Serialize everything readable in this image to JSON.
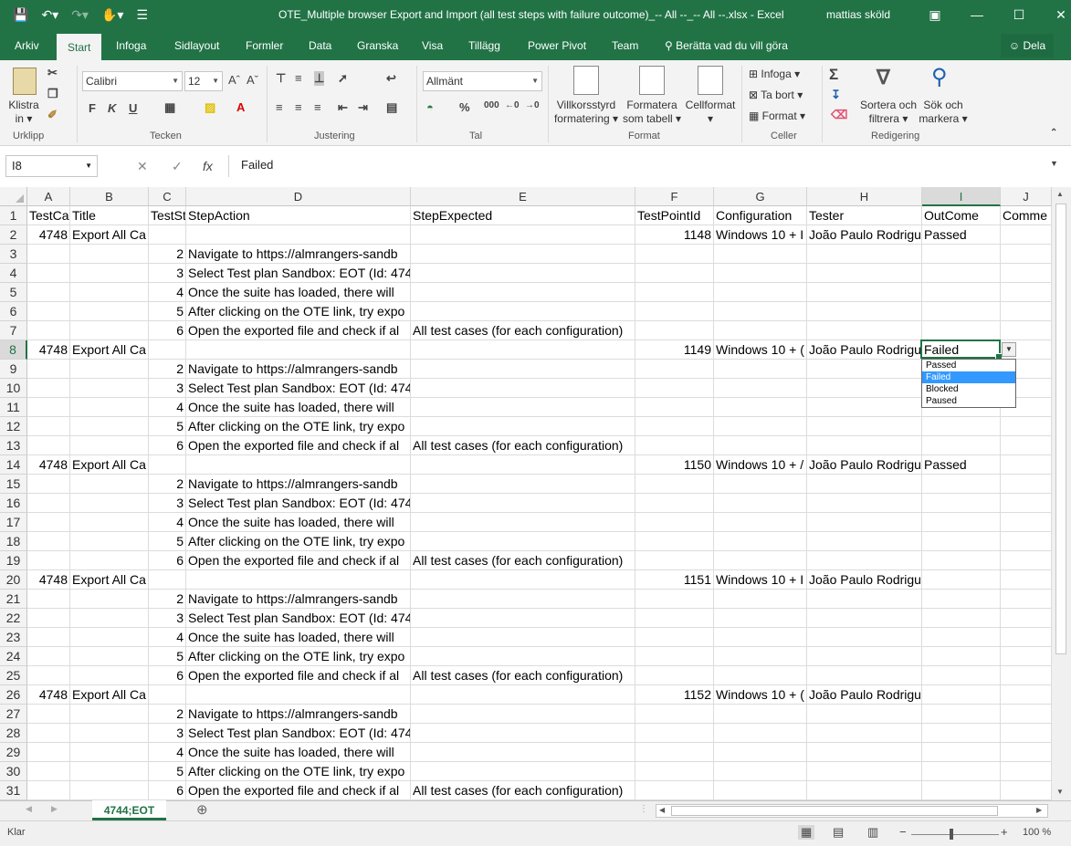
{
  "window": {
    "title": "OTE_Multiple browser Export and Import (all test steps with failure outcome)_-- All --_-- All --.xlsx  -  Excel",
    "user": "mattias sköld"
  },
  "tabs": [
    "Arkiv",
    "Start",
    "Infoga",
    "Sidlayout",
    "Formler",
    "Data",
    "Granska",
    "Visa",
    "Tillägg",
    "Power Pivot",
    "Team"
  ],
  "tell_me": "Berätta vad du vill göra",
  "share_label": "Dela",
  "ribbon": {
    "groups": [
      "Urklipp",
      "Tecken",
      "Justering",
      "Tal",
      "Format",
      "Celler",
      "Redigering"
    ],
    "paste": [
      "Klistra",
      "in"
    ],
    "font_name": "Calibri",
    "font_size": "12",
    "bold": "F",
    "italic": "K",
    "underline": "U",
    "number_format": "Allmänt",
    "cond_format": [
      "Villkorsstyrd",
      "formatering"
    ],
    "format_table": [
      "Formatera",
      "som tabell"
    ],
    "cell_styles": "Cellformat",
    "insert": "Infoga",
    "delete": "Ta bort",
    "format": "Format",
    "sort": [
      "Sortera och",
      "filtrera"
    ],
    "find": [
      "Sök och",
      "markera"
    ]
  },
  "formula_bar": {
    "name_box": "I8",
    "fx": "fx",
    "value": "Failed"
  },
  "columns": [
    "A",
    "B",
    "C",
    "D",
    "E",
    "F",
    "G",
    "H",
    "I",
    "J"
  ],
  "rows": [
    {
      "n": "1",
      "a": "TestCa",
      "b": "Title",
      "c": "TestSt",
      "d": "StepAction",
      "e": "StepExpected",
      "f": "TestPointId",
      "g": "Configuration",
      "h": "Tester",
      "i": "OutCome",
      "j": "Comme"
    },
    {
      "n": "2",
      "a": "4748",
      "b": "Export All Ca",
      "f": "1148",
      "g": "Windows 10 + I",
      "h": "João Paulo Rodrigu",
      "i": "Passed"
    },
    {
      "n": "3",
      "c": "2",
      "d": "Navigate to https://almrangers-sandb"
    },
    {
      "n": "4",
      "c": "3",
      "d": "Select Test plan Sandbox: EOT (Id: 474"
    },
    {
      "n": "5",
      "c": "4",
      "d": "Once the suite has loaded, there will"
    },
    {
      "n": "6",
      "c": "5",
      "d": "After clicking on the OTE link, try expo"
    },
    {
      "n": "7",
      "c": "6",
      "d": "Open the exported file and check if al",
      "e": "All test cases (for each configuration)"
    },
    {
      "n": "8",
      "a": "4748",
      "b": "Export All Ca",
      "f": "1149",
      "g": "Windows 10 + (",
      "h": "João Paulo Rodrigu",
      "i": "Failed"
    },
    {
      "n": "9",
      "c": "2",
      "d": "Navigate to https://almrangers-sandb"
    },
    {
      "n": "10",
      "c": "3",
      "d": "Select Test plan Sandbox: EOT (Id: 474"
    },
    {
      "n": "11",
      "c": "4",
      "d": "Once the suite has loaded, there will"
    },
    {
      "n": "12",
      "c": "5",
      "d": "After clicking on the OTE link, try expo"
    },
    {
      "n": "13",
      "c": "6",
      "d": "Open the exported file and check if al",
      "e": "All test cases (for each configuration)"
    },
    {
      "n": "14",
      "a": "4748",
      "b": "Export All Ca",
      "f": "1150",
      "g": "Windows 10 + /",
      "h": "João Paulo Rodrigu",
      "i": "Passed"
    },
    {
      "n": "15",
      "c": "2",
      "d": "Navigate to https://almrangers-sandb"
    },
    {
      "n": "16",
      "c": "3",
      "d": "Select Test plan Sandbox: EOT (Id: 474"
    },
    {
      "n": "17",
      "c": "4",
      "d": "Once the suite has loaded, there will"
    },
    {
      "n": "18",
      "c": "5",
      "d": "After clicking on the OTE link, try expo"
    },
    {
      "n": "19",
      "c": "6",
      "d": "Open the exported file and check if al",
      "e": "All test cases (for each configuration)"
    },
    {
      "n": "20",
      "a": "4748",
      "b": "Export All Ca",
      "f": "1151",
      "g": "Windows 10 + I",
      "h": "João Paulo Rodrigu"
    },
    {
      "n": "21",
      "c": "2",
      "d": "Navigate to https://almrangers-sandb"
    },
    {
      "n": "22",
      "c": "3",
      "d": "Select Test plan Sandbox: EOT (Id: 474"
    },
    {
      "n": "23",
      "c": "4",
      "d": "Once the suite has loaded, there will"
    },
    {
      "n": "24",
      "c": "5",
      "d": "After clicking on the OTE link, try expo"
    },
    {
      "n": "25",
      "c": "6",
      "d": "Open the exported file and check if al",
      "e": "All test cases (for each configuration)"
    },
    {
      "n": "26",
      "a": "4748",
      "b": "Export All Ca",
      "f": "1152",
      "g": "Windows 10 + (",
      "h": "João Paulo Rodrigu"
    },
    {
      "n": "27",
      "c": "2",
      "d": "Navigate to https://almrangers-sandb"
    },
    {
      "n": "28",
      "c": "3",
      "d": "Select Test plan Sandbox: EOT (Id: 474"
    },
    {
      "n": "29",
      "c": "4",
      "d": "Once the suite has loaded, there will"
    },
    {
      "n": "30",
      "c": "5",
      "d": "After clicking on the OTE link, try expo"
    },
    {
      "n": "31",
      "c": "6",
      "d": "Open the exported file and check if al",
      "e": "All test cases (for each configuration)"
    }
  ],
  "dropdown": {
    "options": [
      "Passed",
      "Failed",
      "Blocked",
      "Paused"
    ],
    "selected": "Failed"
  },
  "sheet_tab": "4744;EOT",
  "status": {
    "ready": "Klar",
    "zoom": "100 %"
  },
  "colors": {
    "accent": "#217346",
    "selection": "#3399ff"
  }
}
